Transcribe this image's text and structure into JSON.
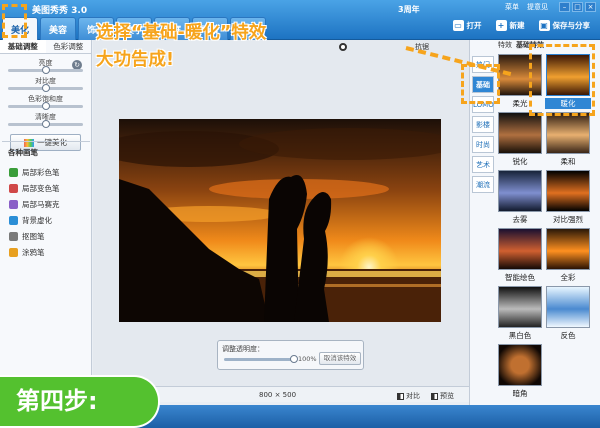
{
  "app": {
    "title": "美图秀秀 3.0",
    "anniversary": "3周年"
  },
  "top_links": [
    "菜单",
    "提意见"
  ],
  "window_controls": [
    "–",
    "□",
    "×"
  ],
  "main_tabs": [
    {
      "label": "美化",
      "active": true
    },
    {
      "label": "美容",
      "active": false
    },
    {
      "label": "饰品",
      "active": false
    },
    {
      "label": "文字",
      "active": false
    },
    {
      "label": "边框",
      "active": false
    },
    {
      "label": "场景",
      "active": false
    },
    {
      "label": "拼图",
      "active": false
    }
  ],
  "toolbar": {
    "open": "打开",
    "new": "新建",
    "save": "保存与分享"
  },
  "left_panel": {
    "tabs": [
      "基础调整",
      "色彩调整"
    ],
    "sliders": [
      {
        "label": "亮度",
        "value": 0.5
      },
      {
        "label": "对比度",
        "value": 0.5
      },
      {
        "label": "色彩饱和度",
        "value": 0.5
      },
      {
        "label": "清晰度",
        "value": 0.5
      }
    ],
    "one_key_button": "一键美化",
    "brushes_title": "各种画笔",
    "brushes": [
      {
        "label": "局部彩色笔",
        "color": "#3a9d3a"
      },
      {
        "label": "局部变色笔",
        "color": "#d04848"
      },
      {
        "label": "局部马赛克",
        "color": "#8a5fc7"
      },
      {
        "label": "背景虚化",
        "color": "#2b8ed6"
      },
      {
        "label": "抠图笔",
        "color": "#7a7a7a"
      },
      {
        "label": "涂鸦笔",
        "color": "#e8a020"
      }
    ]
  },
  "options": {
    "sync_label": "抗锯"
  },
  "opacity_panel": {
    "label": "调整透明度：",
    "value_text": "100%",
    "value": 1.0,
    "cancel": "取消该特效"
  },
  "status": {
    "size": "800 × 500",
    "compare": "对比",
    "preview": "预览"
  },
  "right_panel": {
    "tabs": [
      "特效",
      "基础特效"
    ],
    "categories": [
      {
        "label": "热门",
        "active": false
      },
      {
        "label": "基础",
        "active": true
      },
      {
        "label": "LOMO",
        "active": false
      },
      {
        "label": "影楼",
        "active": false
      },
      {
        "label": "时尚",
        "active": false
      },
      {
        "label": "艺术",
        "active": false
      },
      {
        "label": "潮流",
        "active": false
      }
    ],
    "effects": [
      {
        "label": "柔光",
        "selected": false
      },
      {
        "label": "暖化",
        "selected": true
      },
      {
        "label": "锐化",
        "selected": false
      },
      {
        "label": "柔和",
        "selected": false
      },
      {
        "label": "去雾",
        "selected": false
      },
      {
        "label": "对比强烈",
        "selected": false
      },
      {
        "label": "智能绘色",
        "selected": false
      },
      {
        "label": "全彩",
        "selected": false
      },
      {
        "label": "黑白色",
        "selected": false
      },
      {
        "label": "反色",
        "selected": false
      },
      {
        "label": "暗角",
        "selected": false
      }
    ]
  },
  "overlay": {
    "headline_line1": "选择“基础-暖化”特效",
    "headline_line2": "大功告成!",
    "step": "第四步:"
  }
}
